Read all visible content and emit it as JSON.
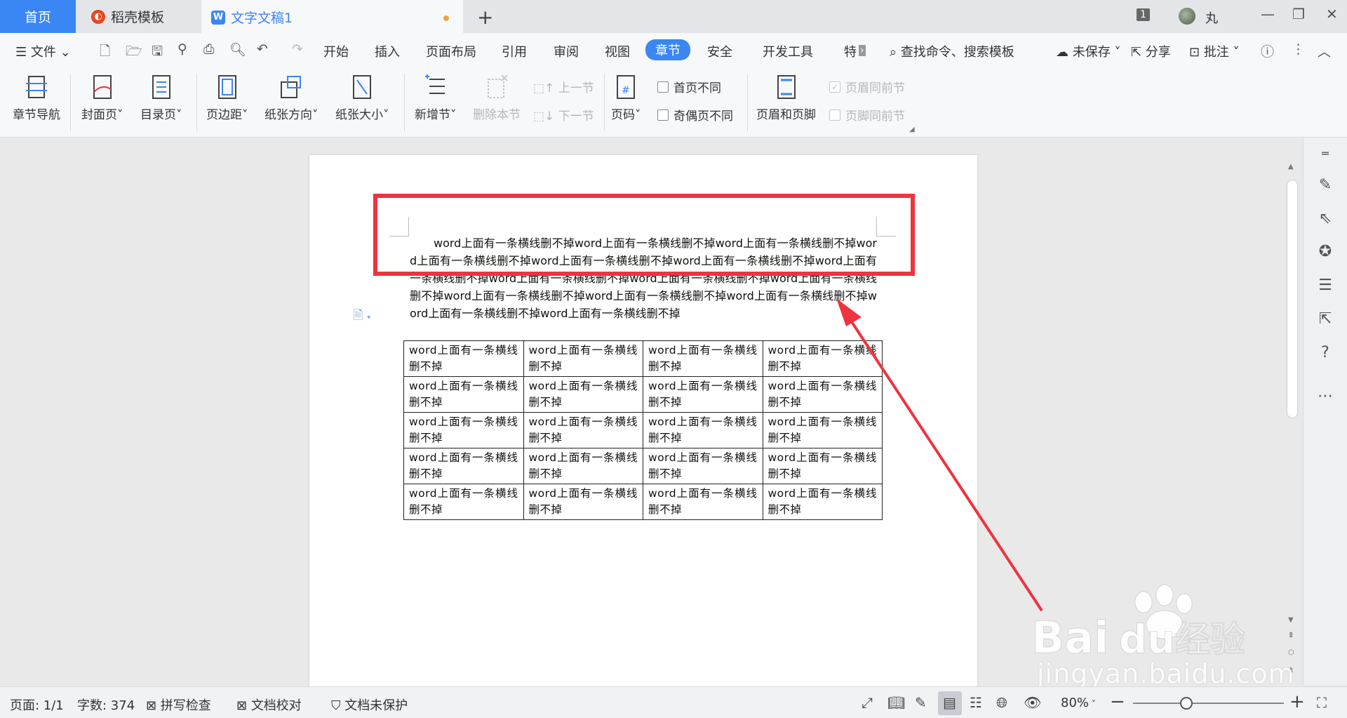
{
  "tabs": {
    "home": "首页",
    "template": "稻壳模板",
    "document": "文字文稿1",
    "add": "+"
  },
  "titlebar": {
    "window_count": "1",
    "user_name": "丸"
  },
  "menu": {
    "file": "文件",
    "items": [
      "开始",
      "插入",
      "页面布局",
      "引用",
      "审阅",
      "视图",
      "章节",
      "安全",
      "开发工具",
      "特"
    ],
    "active": "章节",
    "search": "查找命令、搜索模板",
    "unsaved": "未保存",
    "share": "分享",
    "comment": "批注"
  },
  "ribbon": {
    "section_nav": "章节导航",
    "cover": "封面页",
    "toc": "目录页",
    "margin": "页边距",
    "orientation": "纸张方向",
    "size": "纸张大小",
    "new_section": "新增节",
    "delete_section": "删除本节",
    "prev_section": "上一节",
    "next_section": "下一节",
    "page_number": "页码",
    "first_page_diff": "首页不同",
    "odd_even_diff": "奇偶页不同",
    "header_footer": "页眉和页脚",
    "header_same": "页眉同前节",
    "footer_same": "页脚同前节"
  },
  "document": {
    "paragraph": "word上面有一条横线删不掉word上面有一条横线删不掉word上面有一条横线删不掉word上面有一条横线删不掉word上面有一条横线删不掉word上面有一条横线删不掉word上面有一条横线删不掉word上面有一条横线删不掉word上面有一条横线删不掉word上面有一条横线删不掉word上面有一条横线删不掉word上面有一条横线删不掉word上面有一条横线删不掉word上面有一条横线删不掉word上面有一条横线删不掉",
    "table": [
      [
        "word上面有一条横线删不掉",
        "word上面有一条横线删不掉",
        "word上面有一条横线删不掉",
        "word上面有一条横线删不掉"
      ],
      [
        "word上面有一条横线删不掉",
        "word上面有一条横线删不掉",
        "word上面有一条横线删不掉",
        "word上面有一条横线删不掉"
      ],
      [
        "word上面有一条横线删不掉",
        "word上面有一条横线删不掉",
        "word上面有一条横线删不掉",
        "word上面有一条横线删不掉"
      ],
      [
        "word上面有一条横线删不掉",
        "word上面有一条横线删不掉",
        "word上面有一条横线删不掉",
        "word上面有一条横线删不掉"
      ],
      [
        "word上面有一条横线删不掉",
        "word上面有一条横线删不掉",
        "word上面有一条横线删不掉",
        "word上面有一条横线删不掉"
      ]
    ]
  },
  "status": {
    "page": "页面: 1/1",
    "words": "字数: 374",
    "spell": "拼写检查",
    "proof": "文档校对",
    "protect": "文档未保护",
    "zoom": "80%"
  },
  "watermark": {
    "text": "jingyan.baidu.com"
  },
  "colors": {
    "accent": "#3a86f5",
    "highlight": "#ef3340"
  }
}
